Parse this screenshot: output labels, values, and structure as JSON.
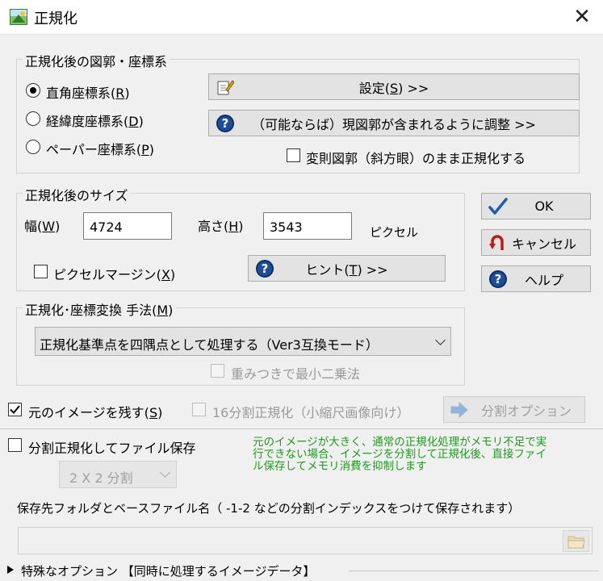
{
  "window": {
    "title": "正規化",
    "close": "✕"
  },
  "group_coords": {
    "legend": "正規化後の図郭・座標系",
    "radios": [
      {
        "label": "直角座標系(",
        "key": "R",
        "suffix": ")",
        "selected": true
      },
      {
        "label": "経緯度座標系(",
        "key": "D",
        "suffix": ")",
        "selected": false
      },
      {
        "label": "ペーパー座標系(",
        "key": "P",
        "suffix": ")",
        "selected": false
      }
    ],
    "settings_btn": {
      "label": "設定(",
      "key": "S",
      "suffix": ") >>"
    },
    "adjust_btn": "（可能ならば）現図郭が含まれるように調整 >>",
    "irregular_check": {
      "label": "変則図郭（斜方眼）のまま正規化する",
      "checked": false
    }
  },
  "group_size": {
    "legend": "正規化後のサイズ",
    "width_label": {
      "label": "幅(",
      "key": "W",
      "suffix": ")"
    },
    "width_value": "4724",
    "height_label": {
      "label": "高さ(",
      "key": "H",
      "suffix": ")"
    },
    "height_value": "3543",
    "unit": "ピクセル",
    "margin_check": {
      "label": "ピクセルマージン(",
      "key": "X",
      "suffix": ")",
      "checked": false
    },
    "hint_btn": {
      "label": "ヒント(",
      "key": "T",
      "suffix": ") >>"
    }
  },
  "group_method": {
    "legend": {
      "label": "正規化･座標変換 手法(",
      "key": "M",
      "suffix": ")"
    },
    "selected": "正規化基準点を四隅点として処理する（Ver3互換モード）",
    "least_squares": {
      "label": "重みつきで最小二乗法",
      "checked": false,
      "enabled": false
    }
  },
  "side_buttons": {
    "ok": "OK",
    "cancel": "キャンセル",
    "help": "ヘルプ"
  },
  "keep_image": {
    "label": "元のイメージを残す(",
    "key": "S",
    "suffix": ")",
    "checked": true
  },
  "split16": {
    "label": "16分割正規化（小縮尺画像向け）",
    "checked": false,
    "enabled": false
  },
  "split_option_btn": "分割オプション",
  "split_save": {
    "label": "分割正規化してファイル保存",
    "checked": false
  },
  "split_note": "元のイメージが大きく、通常の正規化処理がメモリ不足で実\n行できない場合、イメージを分割して正規化後、直接ファイ\nル保存してメモリ消費を抑制します",
  "split_combo": "2 X 2 分割",
  "save_folder_label": "保存先フォルダとベースファイル名（ -1-2 などの分割インデックスをつけて保存されます）",
  "save_folder_value": "",
  "special_options": "特殊なオプション 【同時に処理するイメージデータ】",
  "colors": {
    "accent_blue": "#1c4f96",
    "check_blue": "#1a5fb4",
    "cancel_red": "#c01818",
    "note_green": "#1f9a1f"
  }
}
